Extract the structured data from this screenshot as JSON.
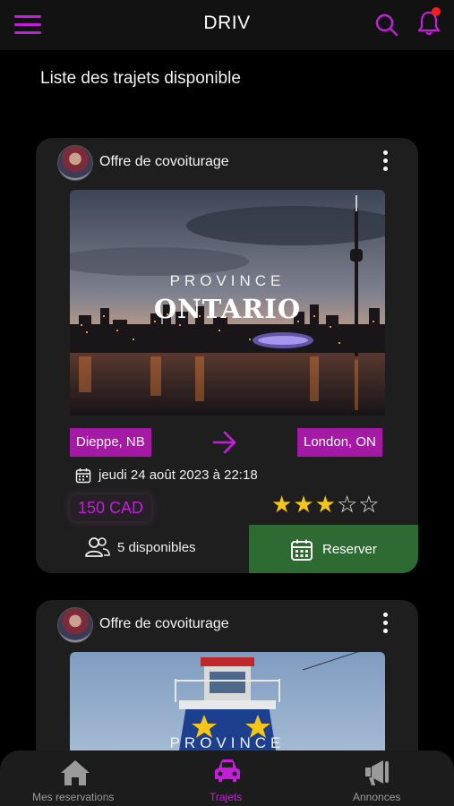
{
  "app": {
    "title": "DRIV",
    "accent_color": "#c21fd8",
    "icons": [
      "menu-icon",
      "search-icon",
      "bell-icon"
    ],
    "notification_indicator": true
  },
  "page": {
    "title": "Liste des trajets disponible"
  },
  "trips": [
    {
      "header": "Offre de covoiturage",
      "image": {
        "province_label": "PROVINCE",
        "province_name": "ONTARIO"
      },
      "from": "Dieppe, NB",
      "to": "London, ON",
      "date": "jeudi 24 août 2023 à 22:18",
      "price": "150 CAD",
      "rating": 3,
      "rating_max": 5,
      "seats": "5 disponibles",
      "reserve_label": "Reserver"
    },
    {
      "header": "Offre de covoiturage",
      "image": {
        "province_label": "PROVINCE"
      }
    }
  ],
  "bottom_nav": [
    {
      "label": "Mes reservations",
      "icon": "home-icon",
      "active": false
    },
    {
      "label": "Trajets",
      "icon": "car-icon",
      "active": true
    },
    {
      "label": "Annonces",
      "icon": "megaphone-icon",
      "active": false
    }
  ]
}
